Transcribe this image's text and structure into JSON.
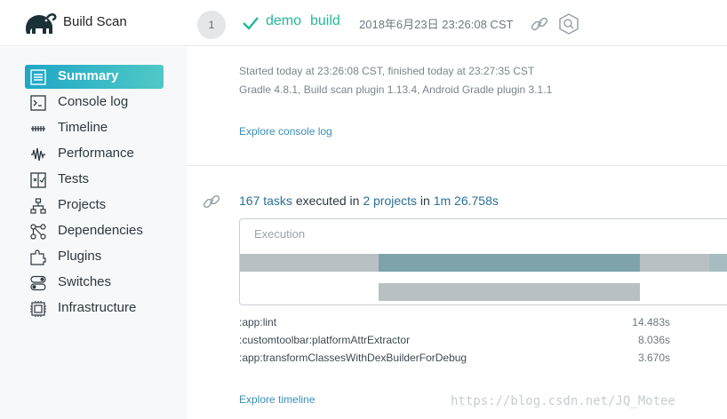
{
  "header": {
    "app_title": "Build Scan",
    "build_number": "1",
    "project": "demo",
    "task": "build",
    "timestamp": "2018年6月23日 23:26:08 CST",
    "icons": [
      "gradle-elephant-logo",
      "check-icon",
      "link-icon",
      "search-icon"
    ]
  },
  "sidebar": {
    "items": [
      {
        "label": "Summary",
        "icon": "summary-icon",
        "active": true
      },
      {
        "label": "Console log",
        "icon": "console-icon"
      },
      {
        "label": "Timeline",
        "icon": "timeline-icon"
      },
      {
        "label": "Performance",
        "icon": "performance-icon"
      },
      {
        "label": "Tests",
        "icon": "tests-icon"
      },
      {
        "label": "Projects",
        "icon": "projects-icon"
      },
      {
        "label": "Dependencies",
        "icon": "dependencies-icon"
      },
      {
        "label": "Plugins",
        "icon": "plugins-icon"
      },
      {
        "label": "Switches",
        "icon": "switches-icon"
      },
      {
        "label": "Infrastructure",
        "icon": "infrastructure-icon"
      }
    ]
  },
  "main": {
    "started_line": "Started today at 23:26:08 CST, finished today at 23:27:35 CST",
    "versions_line": "Gradle 4.8.1,  Build scan plugin 1.13.4,  Android Gradle plugin 3.1.1",
    "explore_console": "Explore console log",
    "tasks_count": "167 tasks",
    "executed_in": " executed in ",
    "projects_count": "2 projects",
    "in_word": " in ",
    "duration": "1m 26.758s",
    "execution_label": "Execution",
    "tasks": [
      {
        "name": ":app:lint",
        "duration": "14.483s"
      },
      {
        "name": ":customtoolbar:platformAttrExtractor",
        "duration": "8.036s"
      },
      {
        "name": ":app:transformClassesWithDexBuilderForDebug",
        "duration": "3.670s"
      }
    ],
    "explore_timeline": "Explore timeline"
  },
  "watermark": "https://blog.csdn.net/JQ_Motee",
  "colors": {
    "accent_green": "#20b89b",
    "link_blue": "#3a8fb7",
    "active_gradient_start": "#1fa7c6",
    "active_gradient_end": "#4fc9c6",
    "bar_active": "#7ea3ab",
    "bar_idle": "#b8c0c4"
  }
}
